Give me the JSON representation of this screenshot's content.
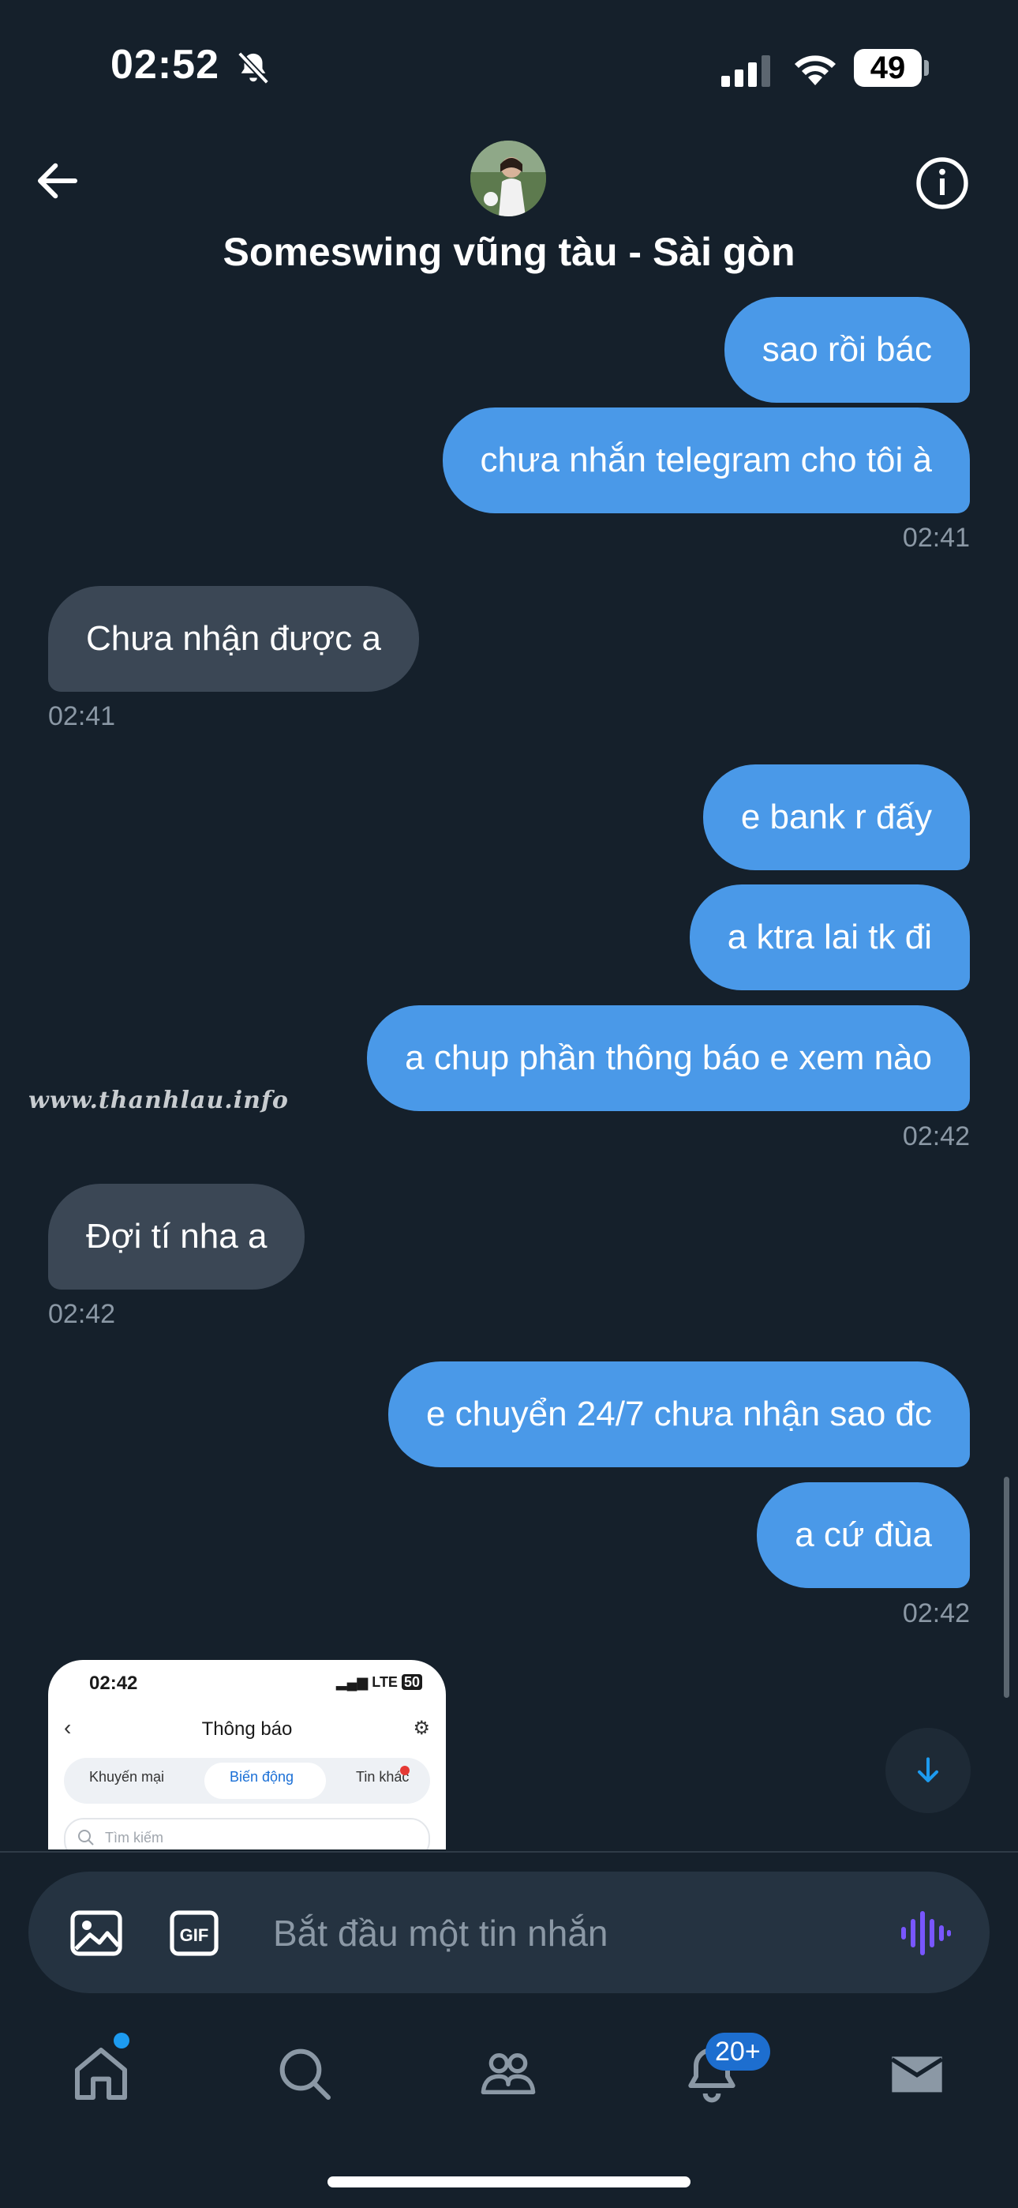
{
  "status_bar": {
    "time": "02:52",
    "battery": "49"
  },
  "header": {
    "title": "Someswing vũng tàu - Sài gòn"
  },
  "watermark": "www.thanhlau.info",
  "messages": [
    {
      "text": "sao rồi bác",
      "direction": "outgoing"
    },
    {
      "text": "chưa nhắn telegram cho tôi à",
      "direction": "outgoing",
      "time": "02:41"
    },
    {
      "text": "Chưa nhận được a",
      "direction": "incoming",
      "time": "02:41"
    },
    {
      "text": "e bank r đấy",
      "direction": "outgoing"
    },
    {
      "text": "a ktra lai tk đi",
      "direction": "outgoing"
    },
    {
      "text": "a chup phần thông báo e xem nào",
      "direction": "outgoing",
      "time": "02:42"
    },
    {
      "text": "Đợi tí nha a",
      "direction": "incoming",
      "time": "02:42"
    },
    {
      "text": "e chuyển 24/7 chưa nhận sao đc",
      "direction": "outgoing"
    },
    {
      "text": "a cứ đùa",
      "direction": "outgoing",
      "time": "02:42"
    }
  ],
  "image_preview": {
    "time": "02:42",
    "status": "LTE",
    "battery": "50",
    "title": "Thông báo",
    "tabs": [
      "Khuyến mại",
      "Biến động",
      "Tin khác"
    ],
    "active_tab": "Biến động",
    "search_placeholder": "Tìm kiếm"
  },
  "composer": {
    "placeholder": "Bắt đầu một tin nhắn"
  },
  "bottom_nav": {
    "notifications_badge": "20+"
  },
  "colors": {
    "background": "#15202b",
    "outgoing_bubble": "#4a99e8",
    "incoming_bubble": "#3b4755",
    "accent": "#1d9bf0",
    "voice": "#7856ff"
  }
}
